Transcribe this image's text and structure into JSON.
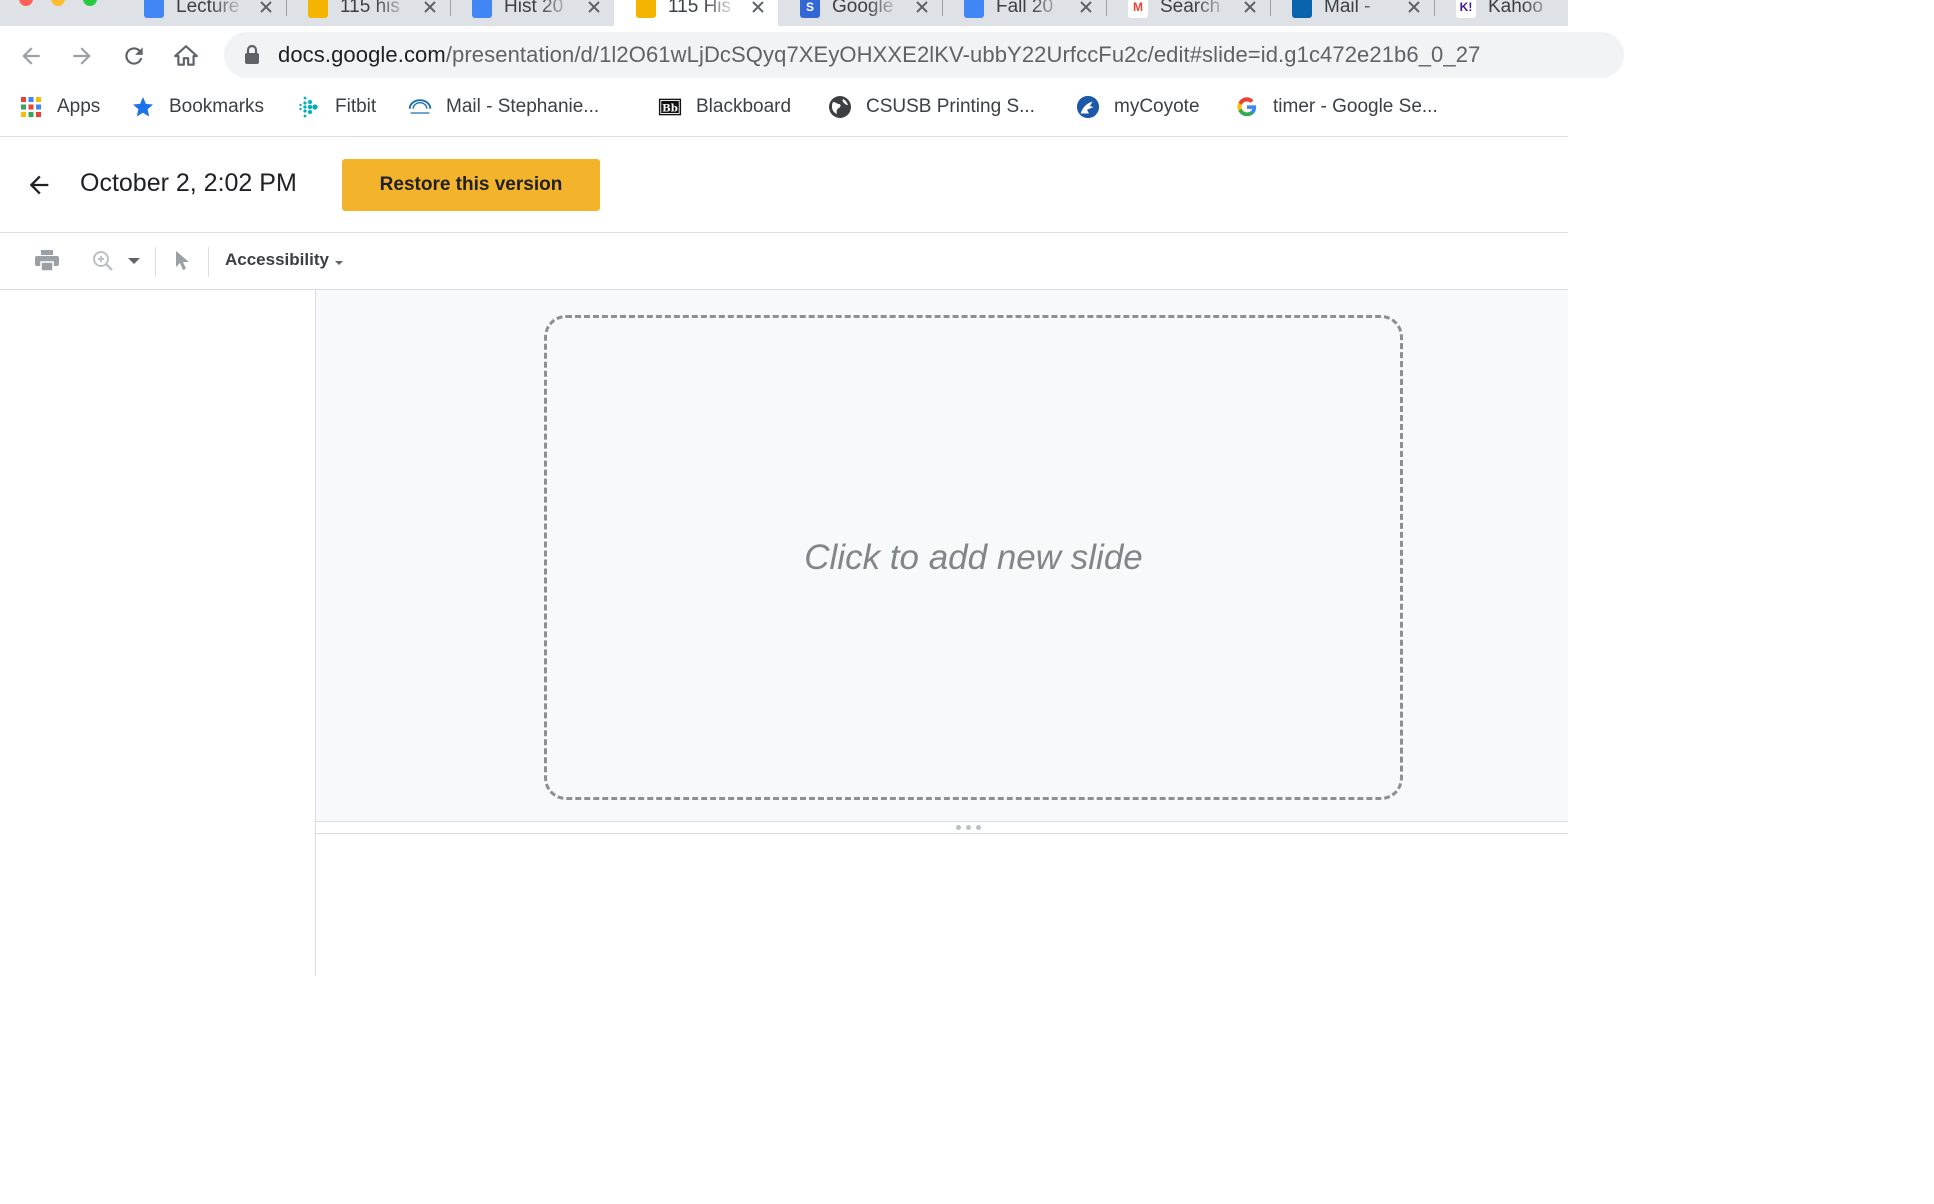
{
  "browser": {
    "tabs": [
      {
        "title": "Lecture",
        "favicon": "google-drive-icon",
        "active": false
      },
      {
        "title": "115 his",
        "favicon": "google-slides-icon",
        "active": false
      },
      {
        "title": "Hist 20",
        "favicon": "google-docs-icon",
        "active": false
      },
      {
        "title": "115 His",
        "favicon": "google-slides-icon",
        "active": true
      },
      {
        "title": "Google",
        "favicon": "google-sites-icon",
        "active": false
      },
      {
        "title": "Fall 20",
        "favicon": "google-docs-icon",
        "active": false
      },
      {
        "title": "Search",
        "favicon": "gmail-icon",
        "active": false
      },
      {
        "title": "Mail -",
        "favicon": "outlook-icon",
        "active": false
      },
      {
        "title": "Kahoo",
        "favicon": "kahoot-icon",
        "active": false
      }
    ],
    "url": {
      "host": "docs.google.com",
      "path": "/presentation/d/1l2O61wLjDcSQyq7XEyOHXXE2lKV-ubbY22UrfccFu2c/edit#slide=id.g1c472e21b6_0_27"
    },
    "bookmarks": [
      {
        "label": "Apps",
        "icon": "apps-grid-icon"
      },
      {
        "label": "Bookmarks",
        "icon": "star-icon"
      },
      {
        "label": "Fitbit",
        "icon": "fitbit-icon"
      },
      {
        "label": "Mail - Stephanie...",
        "icon": "csusb-icon"
      },
      {
        "label": "Blackboard",
        "icon": "blackboard-icon"
      },
      {
        "label": "CSUSB Printing S...",
        "icon": "globe-icon"
      },
      {
        "label": "myCoyote",
        "icon": "coyote-icon"
      },
      {
        "label": "timer - Google Se...",
        "icon": "google-icon"
      }
    ],
    "colors": {
      "tab_strip": "#dee1e6",
      "omnibox": "#f1f3f4",
      "star": "#1a73e8"
    }
  },
  "version_header": {
    "title": "October 2, 2:02 PM",
    "restore_label": "Restore this version",
    "accent": "#f3b32a"
  },
  "viewer_toolbar": {
    "accessibility_label": "Accessibility"
  },
  "canvas": {
    "placeholder": "Click to add new slide"
  }
}
